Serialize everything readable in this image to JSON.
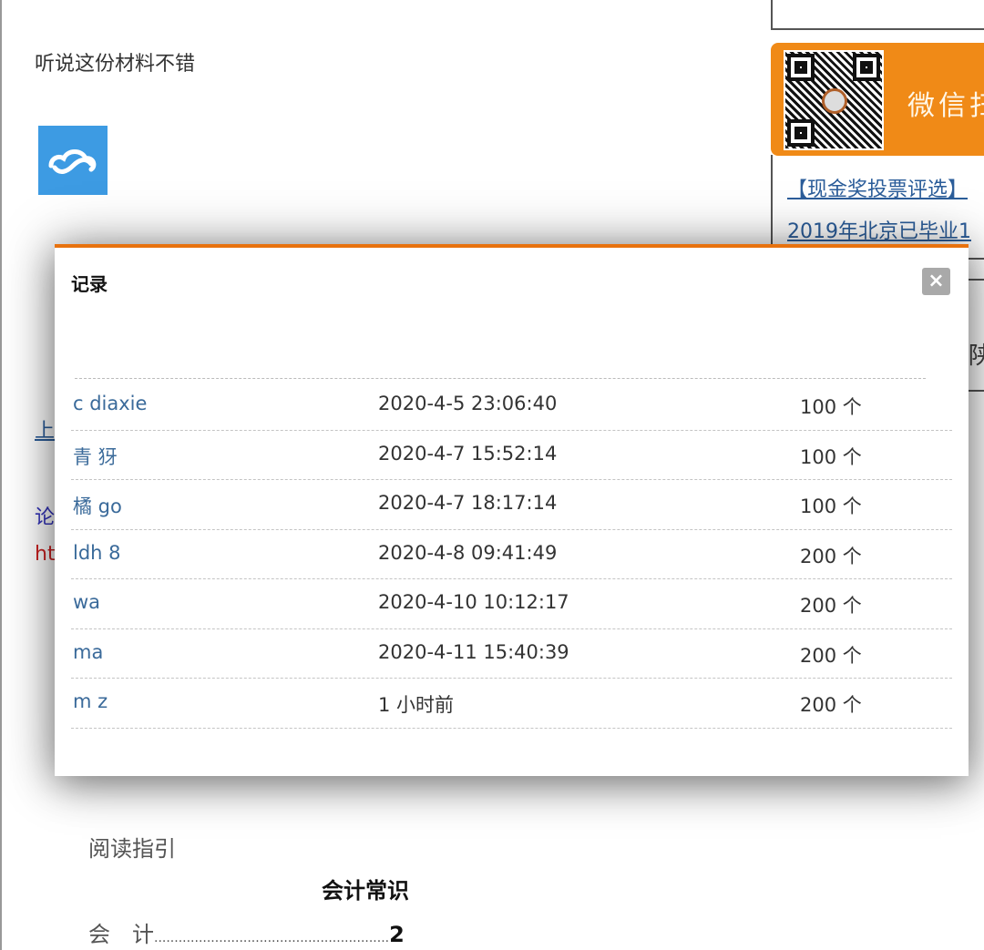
{
  "page": {
    "intro_text": "听说这份材料不错",
    "bg_links": [
      "上",
      "论",
      "ht"
    ],
    "reading_guide": "阅读指引",
    "section_title": "会计常识",
    "toc": [
      {
        "label": "会　计",
        "dots": "..........................................................",
        "page": "2"
      }
    ]
  },
  "sidebar": {
    "banner_text": "微信扫",
    "links": [
      "【现金奖投票评选】",
      "2019年北京已毕业1"
    ],
    "partial_text": "陕"
  },
  "modal": {
    "title": "记录",
    "close_label": "×",
    "accent_color": "#e8720e",
    "rows": [
      {
        "user": "c  diaxie",
        "time": "2020-4-5 23:06:40",
        "amount": "100 个"
      },
      {
        "user": "青  犽",
        "time": "2020-4-7 15:52:14",
        "amount": "100 个"
      },
      {
        "user": "橘       go",
        "time": "2020-4-7 18:17:14",
        "amount": "100 个"
      },
      {
        "user": "ldh       8",
        "time": "2020-4-8 09:41:49",
        "amount": "200 个"
      },
      {
        "user": "wa",
        "time": "2020-4-10 10:12:17",
        "amount": "200 个"
      },
      {
        "user": "ma",
        "time": "2020-4-11 15:40:39",
        "amount": "200 个"
      },
      {
        "user": "m  z",
        "time": "1 小时前",
        "amount": "200 个"
      }
    ]
  }
}
